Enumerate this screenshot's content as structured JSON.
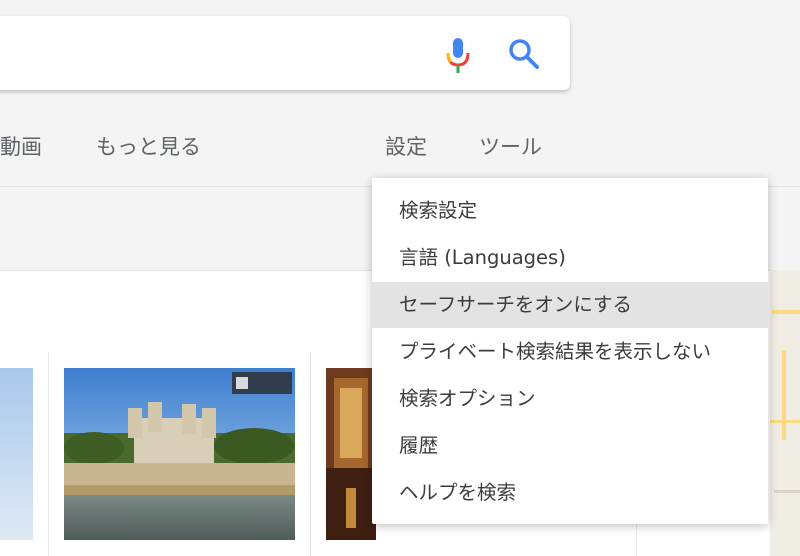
{
  "tabs": {
    "video": "動画",
    "more": "もっと見る",
    "settings": "設定",
    "tools": "ツール"
  },
  "settings_menu": {
    "items": [
      {
        "label": "検索設定",
        "highlighted": false
      },
      {
        "label": "言語 (Languages)",
        "highlighted": false
      },
      {
        "label": "セーフサーチをオンにする",
        "highlighted": true
      },
      {
        "label": "プライベート検索結果を表示しない",
        "highlighted": false
      },
      {
        "label": "検索オプション",
        "highlighted": false
      },
      {
        "label": "履歴",
        "highlighted": false
      },
      {
        "label": "ヘルプを検索",
        "highlighted": false
      }
    ]
  },
  "icons": {
    "mic": "microphone-icon",
    "search": "search-icon"
  },
  "colors": {
    "mic_blue": "#4285f4",
    "mic_red": "#ea4335",
    "mic_yellow": "#fbbc05",
    "mic_green": "#34a853",
    "search_icon": "#4285f4",
    "menu_highlight": "#e3e3e3"
  }
}
